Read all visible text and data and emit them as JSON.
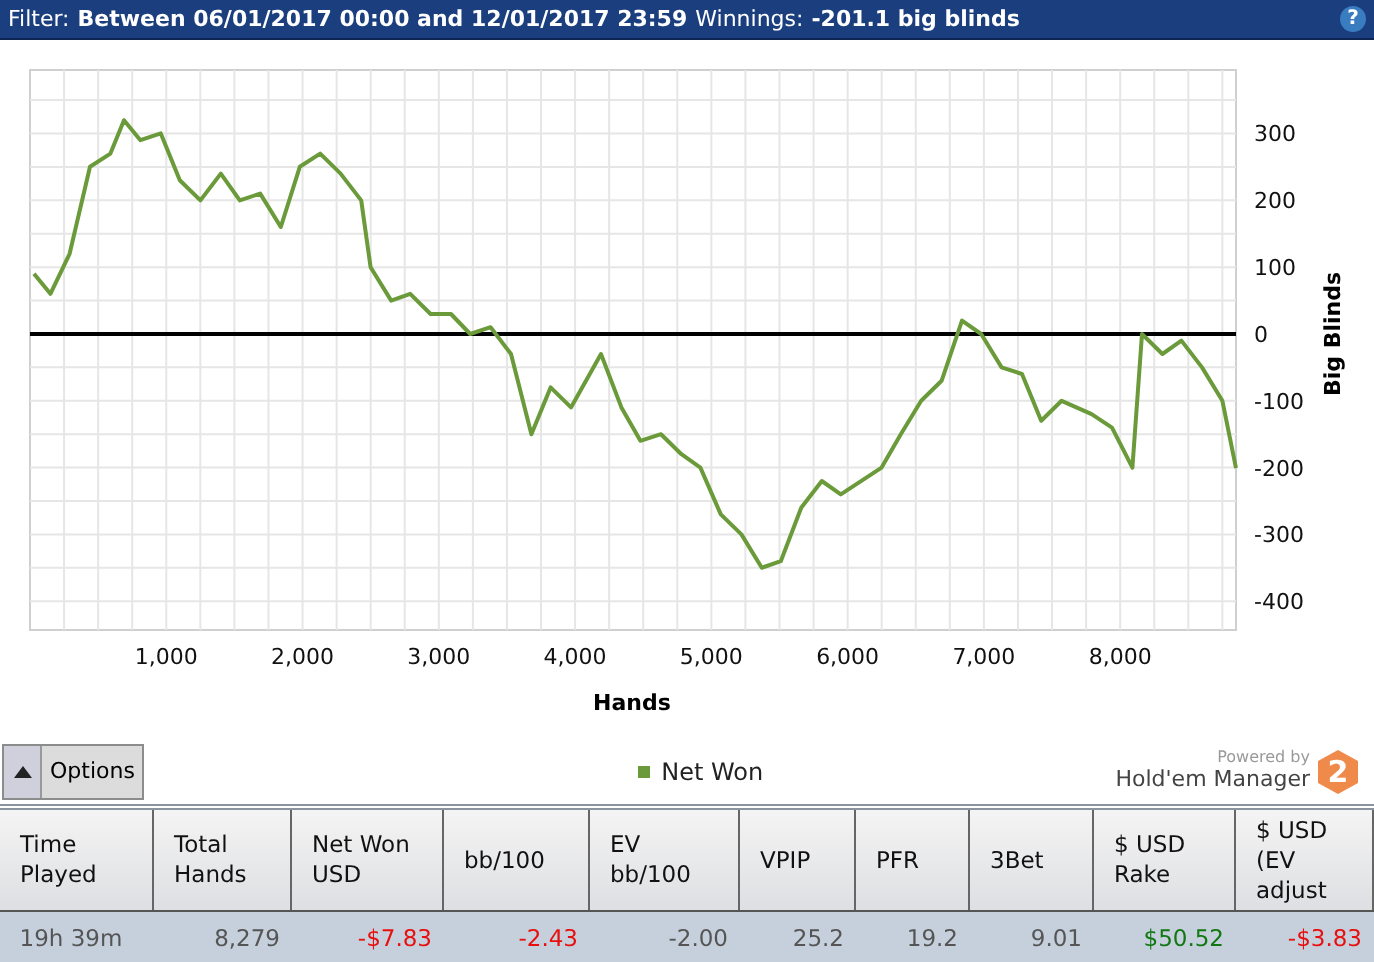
{
  "filter_bar": {
    "filter_label": "Filter:",
    "filter_value": "Between 06/01/2017 00:00 and 12/01/2017 23:59",
    "winnings_label": "Winnings:",
    "winnings_value": "-201.1 big blinds",
    "help": "?"
  },
  "chart": {
    "chart_data": {
      "type": "line",
      "xlabel": "Hands",
      "grid": true,
      "ylabel": "Big Blinds",
      "xlim": [
        0,
        8850
      ],
      "ylim": [
        -443,
        395
      ],
      "xticks": [
        {
          "value": 1000,
          "label": "1,000"
        },
        {
          "value": 2000,
          "label": "2,000"
        },
        {
          "value": 3000,
          "label": "3,000"
        },
        {
          "value": 4000,
          "label": "4,000"
        },
        {
          "value": 5000,
          "label": "5,000"
        },
        {
          "value": 6000,
          "label": "6,000"
        },
        {
          "value": 7000,
          "label": "7,000"
        },
        {
          "value": 8000,
          "label": "8,000"
        }
      ],
      "yticks": [
        -400,
        -300,
        -200,
        -100,
        0,
        100,
        200,
        300
      ],
      "x": [
        30,
        150,
        290,
        440,
        590,
        690,
        810,
        960,
        1100,
        1250,
        1400,
        1540,
        1690,
        1840,
        1980,
        2130,
        2280,
        2430,
        2500,
        2650,
        2790,
        2940,
        3090,
        3230,
        3380,
        3530,
        3680,
        3820,
        3970,
        4190,
        4340,
        4480,
        4630,
        4780,
        4920,
        5070,
        5220,
        5370,
        5510,
        5660,
        5810,
        5950,
        6250,
        6390,
        6540,
        6690,
        6840,
        6980,
        7130,
        7280,
        7420,
        7570,
        7790,
        7940,
        8090,
        8160,
        8310,
        8450,
        8600,
        8750,
        8850
      ],
      "series": [
        {
          "name": "Net Won",
          "color": "#6a9a3a",
          "values": [
            90,
            60,
            120,
            250,
            270,
            320,
            290,
            300,
            230,
            200,
            240,
            200,
            210,
            160,
            250,
            270,
            240,
            200,
            100,
            50,
            60,
            30,
            30,
            0,
            10,
            -30,
            -150,
            -80,
            -110,
            -30,
            -110,
            -160,
            -150,
            -180,
            -200,
            -270,
            -300,
            -350,
            -340,
            -260,
            -220,
            -240,
            -200,
            -150,
            -100,
            -70,
            20,
            0,
            -50,
            -60,
            -130,
            -100,
            -120,
            -140,
            -200,
            0,
            -30,
            -10,
            -50,
            -100,
            -201
          ]
        }
      ]
    }
  },
  "options_button": "Options",
  "branding": {
    "powered_by": "Powered by",
    "product": "Hold'em Manager",
    "badge": "2"
  },
  "table": {
    "columns": [
      "Time Played",
      "Total Hands",
      "Net Won USD",
      "bb/100",
      "EV bb/100",
      "VPIP",
      "PFR",
      "3Bet",
      "$ USD Rake",
      "$ USD (EV adjust"
    ],
    "rows": [
      [
        {
          "text": "19h 39m",
          "kind": "neutral"
        },
        {
          "text": "8,279",
          "kind": "neutral"
        },
        {
          "text": "-$7.83",
          "kind": "negative"
        },
        {
          "text": "-2.43",
          "kind": "negative"
        },
        {
          "text": "-2.00",
          "kind": "neutral"
        },
        {
          "text": "25.2",
          "kind": "neutral"
        },
        {
          "text": "19.2",
          "kind": "neutral"
        },
        {
          "text": "9.01",
          "kind": "neutral"
        },
        {
          "text": "$50.52",
          "kind": "positive"
        },
        {
          "text": "-$3.83",
          "kind": "negative"
        }
      ]
    ]
  }
}
